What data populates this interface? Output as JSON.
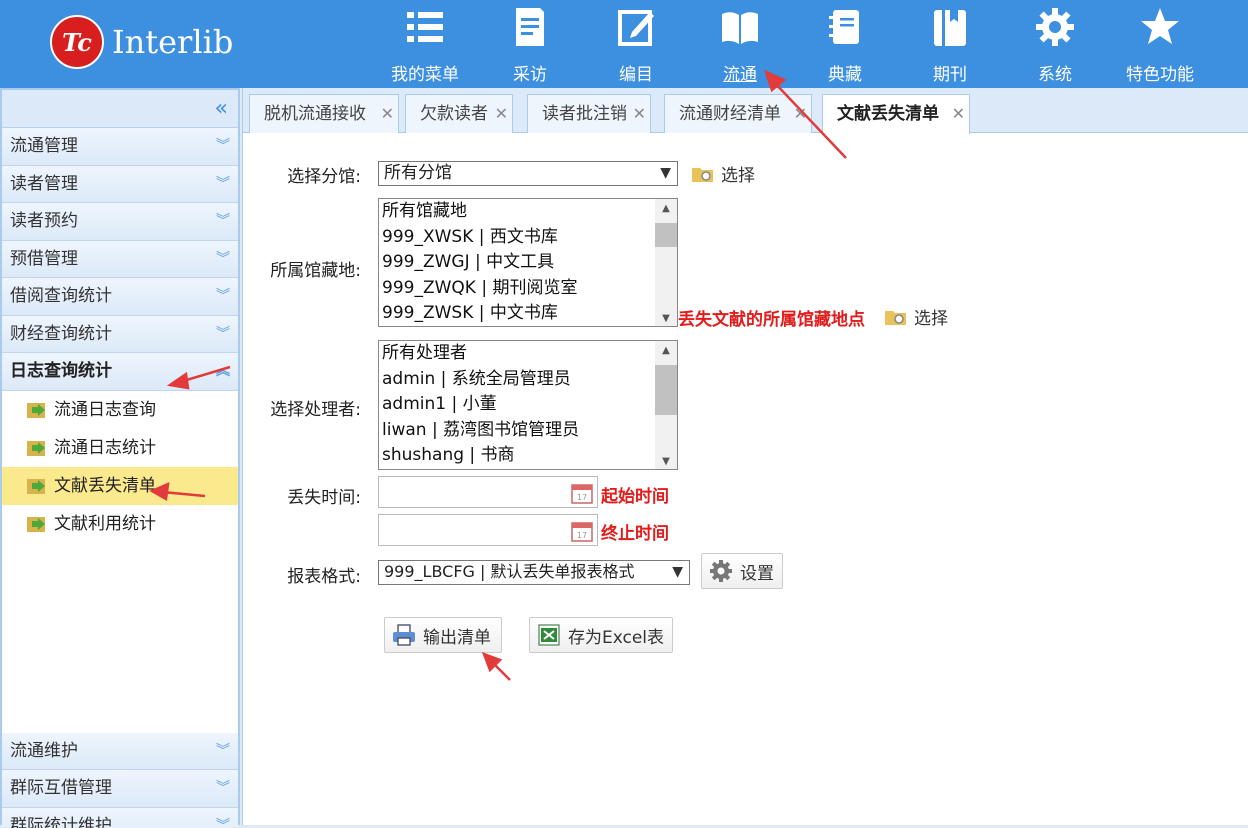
{
  "app": {
    "logo_mark": "Tc",
    "logo_text": "Interlib"
  },
  "nav": [
    {
      "label": "我的菜单",
      "icon": "list-icon"
    },
    {
      "label": "采访",
      "icon": "document-icon"
    },
    {
      "label": "编目",
      "icon": "edit-icon"
    },
    {
      "label": "流通",
      "icon": "open-book-icon",
      "active": true
    },
    {
      "label": "典藏",
      "icon": "notebook-icon"
    },
    {
      "label": "期刊",
      "icon": "journal-icon"
    },
    {
      "label": "系统",
      "icon": "gear-icon"
    },
    {
      "label": "特色功能",
      "icon": "star-icon"
    }
  ],
  "sidebar": {
    "groups_top": [
      "流通管理",
      "读者管理",
      "读者预约",
      "预借管理",
      "借阅查询统计",
      "财经查询统计"
    ],
    "open_group": "日志查询统计",
    "sub_items": [
      "流通日志查询",
      "流通日志统计",
      "文献丢失清单",
      "文献利用统计"
    ],
    "selected_sub": "文献丢失清单",
    "groups_bottom": [
      "流通维护",
      "群际互借管理",
      "群际统计维护"
    ]
  },
  "tabs": [
    "脱机流通接收",
    "欠款读者",
    "读者批注销",
    "流通财经清单",
    "文献丢失清单"
  ],
  "form": {
    "branch_label": "选择分馆:",
    "branch_value": "所有分馆",
    "select_label": "选择",
    "location_label": "所属馆藏地:",
    "locations": [
      "所有馆藏地",
      "999_XWSK | 西文书库",
      "999_ZWGJ | 中文工具",
      "999_ZWQK | 期刊阅览室",
      "999_ZWSK | 中文书库"
    ],
    "location_note": "丢失文献的所属馆藏地点",
    "handler_label": "选择处理者:",
    "handlers": [
      "所有处理者",
      "admin | 系统全局管理员",
      "admin1 | 小董",
      "liwan | 荔湾图书馆管理员",
      "shushang | 书商"
    ],
    "lost_time_label": "丢失时间:",
    "start_time_value": "",
    "end_time_value": "",
    "start_note": "起始时间",
    "end_note": "终止时间",
    "format_label": "报表格式:",
    "format_value": "999_LBCFG | 默认丢失单报表格式",
    "settings_label": "设置",
    "output_label": "输出清单",
    "excel_label": "存为Excel表"
  },
  "colors": {
    "header": "#3d8fdf",
    "note_red": "#e21b1b",
    "selected_bg": "#fbe98e"
  }
}
